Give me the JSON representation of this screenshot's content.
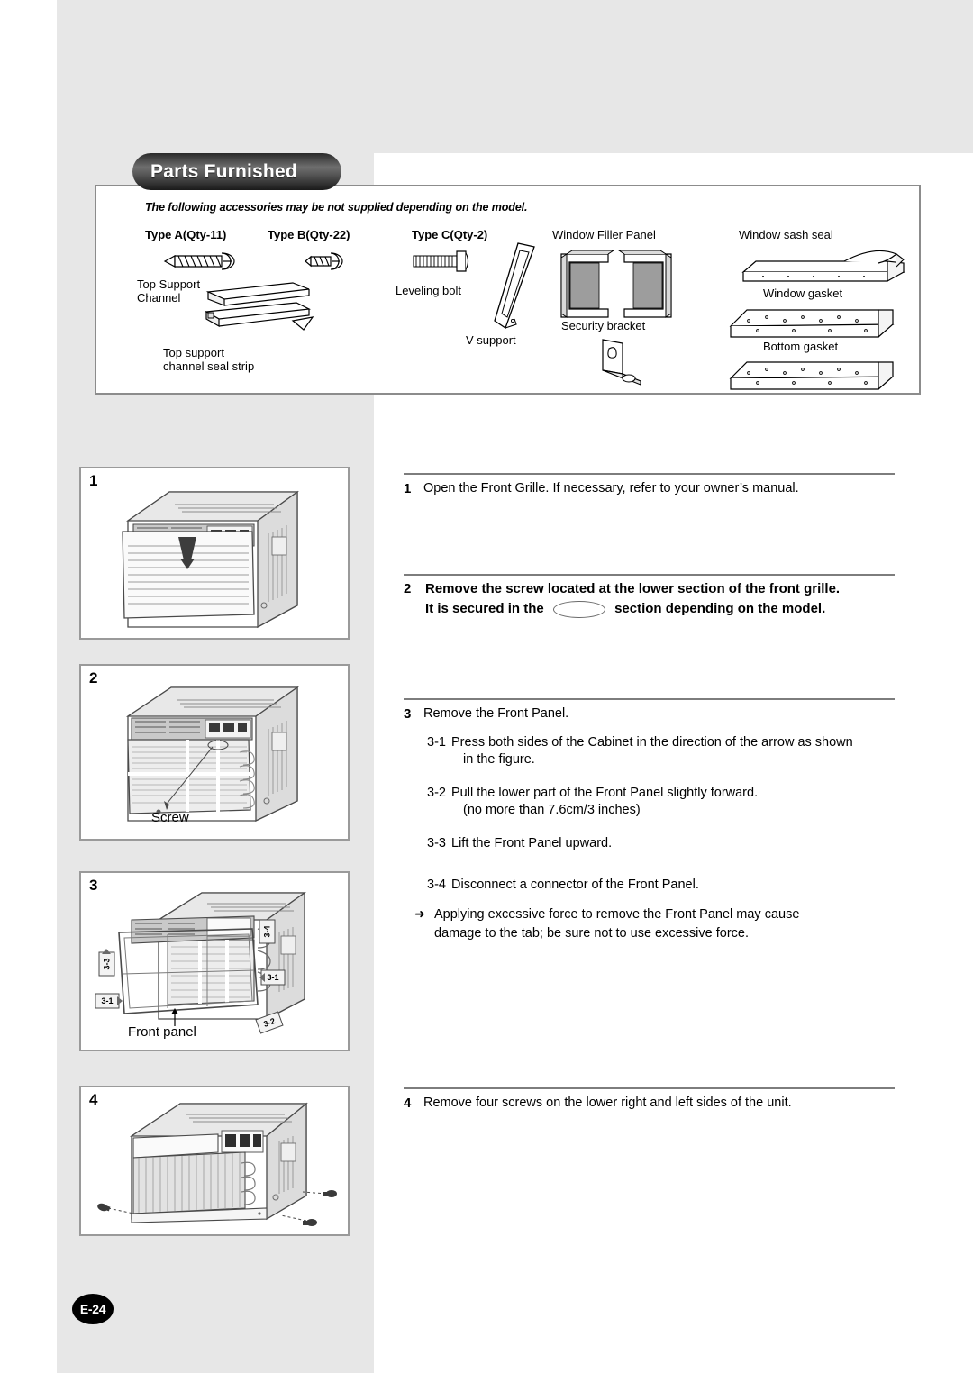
{
  "page": {
    "number_badge": "E-24"
  },
  "parts_section": {
    "title": "Parts Furnished",
    "note": "The following accessories may be not supplied depending on the model.",
    "columns": [
      {
        "heading": "Type A(Qty-11)",
        "captions": [
          "Top Support",
          "Channel",
          "Top support",
          "channel seal strip"
        ]
      },
      {
        "heading": "Type B(Qty-22)",
        "captions": []
      },
      {
        "heading": "Type C(Qty-2)",
        "captions": [
          "Leveling bolt",
          "V-support"
        ]
      },
      {
        "heading": "Window Filler Panel",
        "captions": [
          "Security bracket"
        ]
      },
      {
        "heading": "Window sash seal",
        "captions": [
          "Window gasket",
          "Bottom gasket"
        ]
      }
    ],
    "labels": {
      "type_a": "Type A(Qty-11)",
      "type_b": "Type B(Qty-22)",
      "type_c": "Type C(Qty-2)",
      "window_filler_panel": "Window Filler Panel",
      "window_sash_seal": "Window sash seal",
      "top_support": "Top Support",
      "channel": "Channel",
      "top_support_strip_l1": "Top support",
      "top_support_strip_l2": "channel seal strip",
      "leveling_bolt": "Leveling bolt",
      "v_support": "V-support",
      "security_bracket": "Security bracket",
      "window_gasket": "Window gasket",
      "bottom_gasket": "Bottom gasket"
    }
  },
  "figures": [
    {
      "number": "1",
      "label": ""
    },
    {
      "number": "2",
      "label": "Screw"
    },
    {
      "number": "3",
      "label": "Front panel",
      "callouts": [
        "3-1",
        "3-1",
        "3-2",
        "3-3",
        "3-4"
      ]
    },
    {
      "number": "4",
      "label": ""
    }
  ],
  "instructions": {
    "step1": {
      "number": "1",
      "text": "Open the Front Grille. If necessary, refer to your owner’s manual."
    },
    "step2": {
      "number": "2",
      "line1": "Remove the screw located at the lower section of the front grille.",
      "line2_a": "It is secured in the",
      "line2_b": "section depending on the model."
    },
    "step3": {
      "number": "3",
      "text": "Remove the Front Panel.",
      "substeps": [
        {
          "number": "3-1",
          "text": "Press both sides of the Cabinet in the direction of the arrow as shown",
          "cont": "in the figure."
        },
        {
          "number": "3-2",
          "text": "Pull the lower part of the Front Panel slightly forward.",
          "cont": "(no more than 7.6cm/3 inches)"
        },
        {
          "number": "3-3",
          "text": "Lift the Front Panel upward.",
          "cont": ""
        },
        {
          "number": "3-4",
          "text": "Disconnect a connector of the Front Panel.",
          "cont": ""
        }
      ],
      "warning": {
        "bullet": "➜",
        "line1": "Applying excessive force to remove the Front Panel  may cause",
        "line2": "damage to the tab; be sure not to use excessive force."
      }
    },
    "step4": {
      "number": "4",
      "text": "Remove four screws on the lower right and left sides of the unit."
    }
  },
  "colors": {
    "page_background": "#ffffff",
    "gray_panel": "#e7e7e7",
    "box_border": "#8c8c8c",
    "rule": "#7d7d7d",
    "badge_background": "#000000"
  }
}
